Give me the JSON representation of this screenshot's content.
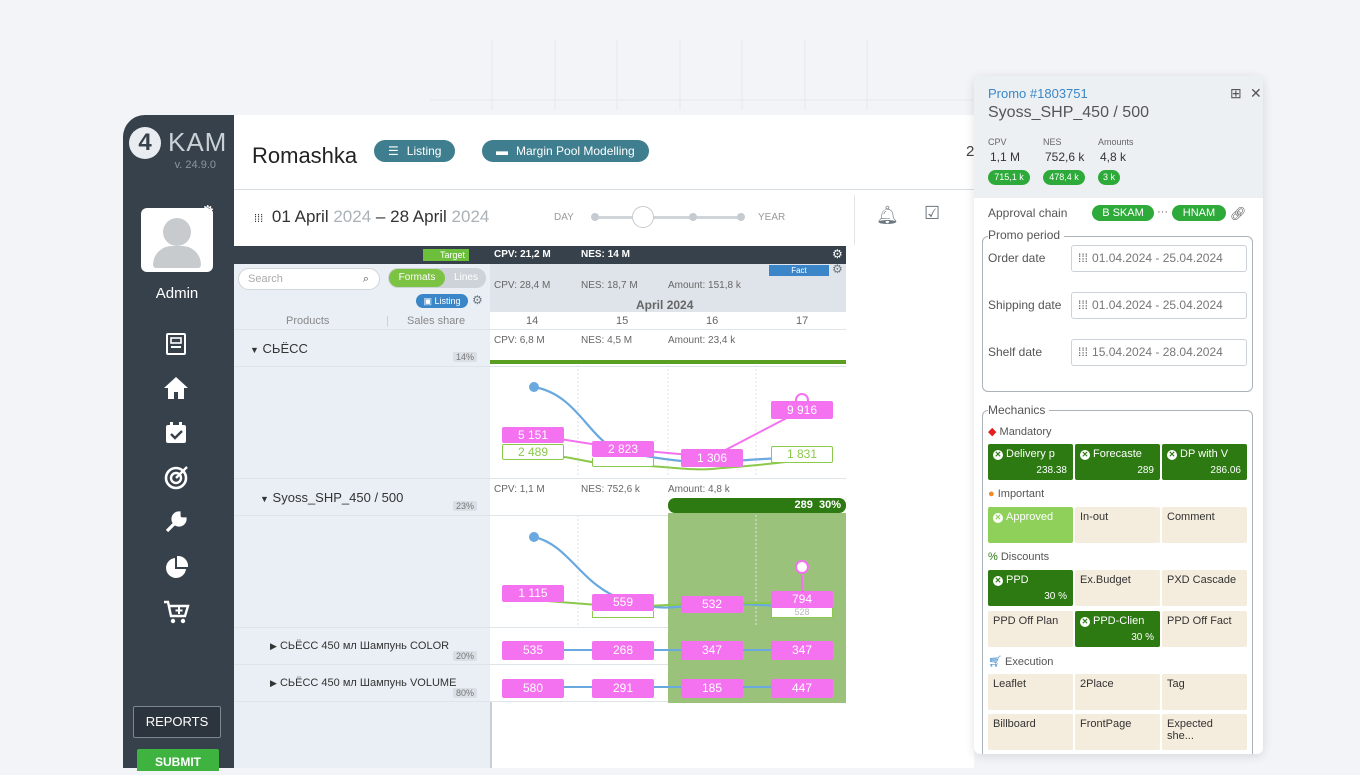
{
  "app": {
    "logo_letter": "4",
    "logo_text": "KAM",
    "version": "v. 24.9.0"
  },
  "user": {
    "name": "Admin"
  },
  "sidebar": {
    "reports_label": "REPORTS",
    "submit_label": "SUBMIT",
    "icons": [
      "clipboard-icon",
      "home-icon",
      "calendar-check-icon",
      "target-icon",
      "wrench-icon",
      "pie-chart-icon",
      "cart-plus-icon"
    ]
  },
  "header": {
    "title": "Romashka",
    "listing_label": "Listing",
    "margin_label": "Margin Pool Modelling",
    "right_number": "2"
  },
  "period": {
    "start_day": "01 April",
    "start_year": "2024",
    "dash": "–",
    "end_day": "28 April",
    "end_year": "2024",
    "day_label": "DAY",
    "year_label": "YEAR"
  },
  "grid": {
    "target_tag": "Target",
    "cpv_target": "CPV: 21,2 M",
    "nes_target": "NES: 14 M",
    "search_placeholder": "Search",
    "formats_label": "Formats",
    "lines_label": "Lines",
    "listing_chip": "Listing",
    "col_products": "Products",
    "col_sales_share": "Sales share",
    "fact_tag": "Fact",
    "cpv_fact": "CPV: 28,4 M",
    "nes_fact": "NES: 18,7 M",
    "amount_fact": "Amount: 151,8 k",
    "month": "April",
    "month_year": "2024",
    "days": [
      "14",
      "15",
      "16",
      "17"
    ]
  },
  "rows": {
    "group1": {
      "name": "СЬЁСС",
      "share": "14%",
      "cpv": "CPV: 6,8 M",
      "nes": "NES: 4,5 M",
      "amount": "Amount: 23,4 k"
    },
    "group2": {
      "name": "Syoss_SHP_450 / 500",
      "share": "23%",
      "cpv": "CPV: 1,1 M",
      "nes": "NES: 752,6 k",
      "amount": "Amount: 4,8 k",
      "bar_value": "289",
      "bar_pct": "30%"
    },
    "sub1": {
      "name": "СЬЁСС 450 мл Шампунь COLOR",
      "share": "20%"
    },
    "sub2": {
      "name": "СЬЁСС 450 мл Шампунь VOLUME",
      "share": "80%"
    }
  },
  "chart_labels": {
    "g1_pink": [
      "5 151",
      "2 823",
      "1 306",
      "9 916"
    ],
    "g1_green": [
      "2 489",
      "1 831"
    ],
    "g2_pink": [
      "1 115",
      "559",
      "532",
      "794"
    ],
    "g2_hidden": "528",
    "sub1_pink": [
      "535",
      "268",
      "347",
      "347"
    ],
    "sub2_pink": [
      "580",
      "291",
      "185",
      "447"
    ]
  },
  "panel": {
    "promo_id": "Promo #1803751",
    "promo_name": "Syoss_SHP_450 / 500",
    "cpv_label": "CPV",
    "cpv_value": "1,1 M",
    "cpv_badge": "715,1 k",
    "nes_label": "NES",
    "nes_value": "752,6 k",
    "nes_badge": "478,4 k",
    "amounts_label": "Amounts",
    "amounts_value": "4,8 k",
    "amounts_badge": "3 k",
    "approval_label": "Approval chain",
    "approver1": "B SKAM",
    "approver_sep": "···",
    "approver2": "HNAM",
    "promo_period_label": "Promo period",
    "order_label": "Order date",
    "order_value": "01.04.2024 - 25.04.2024",
    "shipping_label": "Shipping date",
    "shipping_value": "01.04.2024 - 25.04.2024",
    "shelf_label": "Shelf date",
    "shelf_value": "15.04.2024 - 28.04.2024",
    "mechanics_label": "Mechanics",
    "mandatory_label": "Mandatory",
    "mandatory": [
      {
        "name": "Delivery p",
        "value": "238.38"
      },
      {
        "name": "Forecaste",
        "value": "289"
      },
      {
        "name": "DP with V",
        "value": "286.06"
      }
    ],
    "important_label": "Important",
    "important": [
      "Approved",
      "In-out",
      "Comment"
    ],
    "discounts_label": "Discounts",
    "discounts_row1": [
      {
        "name": "PPD",
        "value": "30 %"
      },
      {
        "name": "Ex.Budget",
        "value": ""
      },
      {
        "name": "PXD Cascade",
        "value": ""
      }
    ],
    "discounts_row2": [
      {
        "name": "PPD Off Plan",
        "value": ""
      },
      {
        "name": "PPD-Clien",
        "value": "30 %"
      },
      {
        "name": "PPD Off Fact",
        "value": ""
      }
    ],
    "execution_label": "Execution",
    "execution_row1": [
      "Leaflet",
      "2Place",
      "Tag"
    ],
    "execution_row2": [
      "Billboard",
      "FrontPage",
      "Expected she..."
    ]
  },
  "colors": {
    "accent_green": "#2d7a12",
    "badge_green": "#2eaa3a",
    "pink": "#f472f0",
    "blue_line": "#6aa8e0",
    "sidebar": "#37414b"
  }
}
